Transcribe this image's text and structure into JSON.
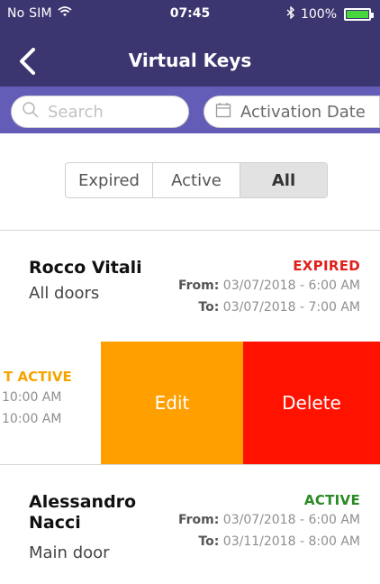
{
  "status_bar": {
    "carrier": "No SIM",
    "time": "07:45",
    "battery": "100%",
    "battery_level": 1.0
  },
  "nav": {
    "title": "Virtual Keys"
  },
  "search": {
    "placeholder": "Search",
    "date_filter_label": "Activation Date"
  },
  "segments": {
    "items": [
      "Expired",
      "Active",
      "All"
    ],
    "selected": "All"
  },
  "keys": [
    {
      "name": "Rocco Vitali",
      "doors": "All doors",
      "status": "EXPIRED",
      "status_color": "#e0201b",
      "from_label": "From:",
      "from": "03/07/2018 - 6:00 AM",
      "to_label": "To:",
      "to": "03/07/2018 - 7:00 AM"
    },
    {
      "status_fragment": "T ACTIVE",
      "time1": "10:00 AM",
      "time2": "10:00 AM",
      "status_color": "#f5a400"
    },
    {
      "name_line1": "Alessandro",
      "name_line2": "Nacci",
      "doors": "Main door",
      "status": "ACTIVE",
      "status_color": "#2a8a24",
      "from_label": "From:",
      "from": "03/07/2018 - 6:00 AM",
      "to_label": "To:",
      "to": "03/11/2018 - 8:00 AM"
    }
  ],
  "swipe_actions": {
    "edit_label": "Edit",
    "delete_label": "Delete",
    "edit_color": "#ff9f00",
    "delete_color": "#ff1200"
  },
  "colors": {
    "header": "#3c3670",
    "search_bar": "#645db8"
  }
}
